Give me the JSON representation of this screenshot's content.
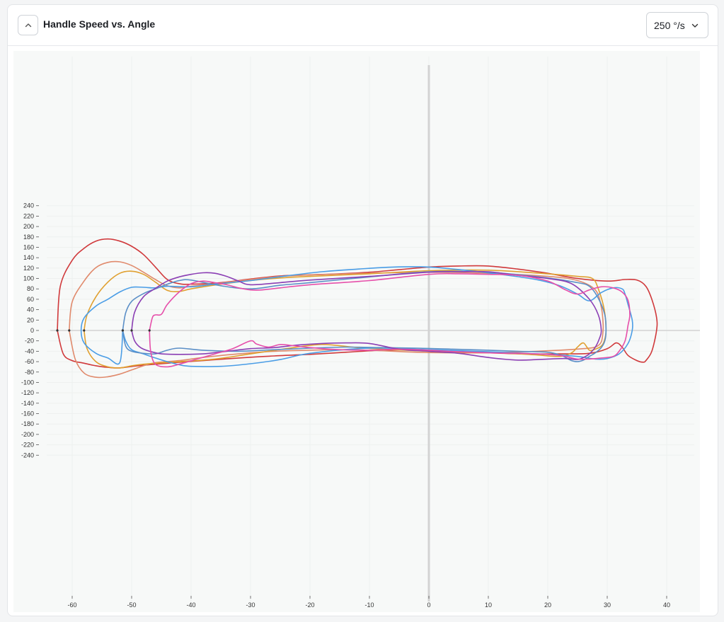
{
  "header": {
    "title": "Handle Speed vs. Angle",
    "speed_select_value": "250 °/s",
    "collapse_icon": "chevron-up-icon",
    "dropdown_icon": "chevron-down-icon"
  },
  "chart_data": {
    "type": "line",
    "title": "Handle Speed vs. Angle",
    "xlabel": "",
    "ylabel": "",
    "xlim": [
      -66,
      46
    ],
    "ylim": [
      -250,
      255
    ],
    "xticks": [
      -60,
      -50,
      -40,
      -30,
      -20,
      -10,
      0,
      10,
      20,
      30,
      40
    ],
    "yticks": [
      240,
      220,
      200,
      180,
      160,
      140,
      120,
      100,
      80,
      60,
      40,
      20,
      0,
      -20,
      -40,
      -60,
      -80,
      -100,
      -120,
      -140,
      -160,
      -180,
      -200,
      -220,
      -240
    ],
    "grid": true,
    "legend": "none",
    "series": [
      {
        "color": "#d0393b",
        "x": [
          -62.5,
          -62,
          -60,
          -58,
          -56,
          -54,
          -52,
          -50,
          -48,
          -46,
          -44,
          -42,
          -40,
          -35,
          -30,
          -25,
          -20,
          -15,
          -10,
          -5,
          0,
          5,
          10,
          15,
          20,
          25,
          30,
          33,
          35,
          36.5,
          37.5,
          38.3,
          38.3,
          37.5,
          36.5,
          36,
          35,
          33.5,
          32.5,
          31.5,
          30,
          27,
          22,
          16,
          10,
          4,
          -2,
          -8,
          -14,
          -20,
          -26,
          -32,
          -38,
          -44,
          -49,
          -52,
          -54,
          -56,
          -58,
          -60,
          -61.5,
          -62.5
        ],
        "y": [
          0,
          85,
          135,
          158,
          172,
          176,
          172,
          162,
          146,
          122,
          98,
          90,
          89,
          92,
          99,
          105,
          107,
          109,
          112,
          117,
          122,
          124,
          124,
          118,
          110,
          100,
          95,
          98,
          97,
          85,
          60,
          25,
          0,
          -40,
          -58,
          -61,
          -58,
          -48,
          -32,
          -24,
          -35,
          -44,
          -45,
          -45,
          -43,
          -41,
          -38,
          -38,
          -42,
          -46,
          -49,
          -53,
          -58,
          -63,
          -68,
          -72,
          -71,
          -68,
          -63,
          -58,
          -45,
          0
        ]
      },
      {
        "color": "#e08a6c",
        "x": [
          -60.5,
          -60,
          -58,
          -56,
          -54,
          -52,
          -50,
          -48,
          -46,
          -44,
          -42,
          -40,
          -35,
          -30,
          -25,
          -20,
          -10,
          0,
          10,
          20,
          25,
          28,
          29,
          29.3,
          29.3,
          29,
          28,
          26,
          22,
          16,
          10,
          4,
          -2,
          -8,
          -14,
          -20,
          -26,
          -32,
          -38,
          -42,
          -46,
          -48,
          -50,
          -52,
          -54,
          -56,
          -58,
          -59.5,
          -60.5
        ],
        "y": [
          0,
          55,
          95,
          121,
          131,
          132,
          125,
          112,
          98,
          86,
          82,
          85,
          91,
          98,
          104,
          107,
          110,
          112,
          110,
          104,
          96,
          78,
          45,
          15,
          0,
          -22,
          -32,
          -35,
          -38,
          -41,
          -43,
          -43,
          -42,
          -39,
          -37,
          -38,
          -40,
          -45,
          -52,
          -58,
          -62,
          -68,
          -76,
          -84,
          -89,
          -90,
          -82,
          -55,
          0
        ]
      },
      {
        "color": "#e0a030",
        "x": [
          -58,
          -57.5,
          -56,
          -54,
          -52,
          -50,
          -48,
          -46,
          -44,
          -42,
          -40,
          -35,
          -30,
          -25,
          -20,
          -10,
          0,
          10,
          20,
          25,
          27.5,
          28.5,
          29.5,
          29.8,
          29.5,
          29,
          28,
          27,
          26,
          25,
          24,
          22,
          18,
          12,
          6,
          0,
          -6,
          -12,
          -18,
          -24,
          -30,
          -36,
          -42,
          -46,
          -48,
          -50,
          -52,
          -54,
          -56,
          -57.5,
          -58
        ],
        "y": [
          0,
          30,
          65,
          93,
          110,
          114,
          108,
          93,
          77,
          75,
          80,
          89,
          96,
          101,
          104,
          109,
          115,
          116,
          109,
          104,
          100,
          80,
          40,
          0,
          -20,
          -30,
          -36,
          -38,
          -24,
          -32,
          -43,
          -50,
          -47,
          -43,
          -42,
          -40,
          -37,
          -33,
          -27,
          -35,
          -45,
          -55,
          -60,
          -63,
          -65,
          -68,
          -72,
          -70,
          -60,
          -35,
          0
        ]
      },
      {
        "color": "#4a9de6",
        "x": [
          -51.5,
          -51,
          -50,
          -48,
          -46,
          -44,
          -42,
          -40,
          -35,
          -30,
          -25,
          -20,
          -10,
          0,
          10,
          20,
          25,
          28,
          30,
          32,
          33.5,
          34.2,
          34.2,
          33.5,
          33,
          32.5,
          31,
          29,
          27,
          25,
          22,
          18,
          12,
          6,
          0,
          -6,
          -12,
          -18,
          -24,
          -30,
          -36,
          -40,
          -44,
          -46,
          -48,
          -50,
          -52,
          -54,
          -56,
          -58,
          -58.5,
          -58,
          -56,
          -54,
          -52,
          -51.5
        ],
        "y": [
          0,
          -20,
          -37,
          -45,
          -53,
          -60,
          -66,
          -69,
          -69,
          -64,
          -56,
          -44,
          -34,
          -37,
          -41,
          -46,
          -50,
          -55,
          -54,
          -45,
          -25,
          0,
          20,
          50,
          70,
          80,
          82,
          73,
          57,
          70,
          86,
          98,
          108,
          116,
          122,
          122,
          118,
          113,
          105,
          96,
          89,
          84,
          85,
          82,
          83,
          83,
          74,
          60,
          47,
          24,
          0,
          -24,
          -44,
          -53,
          -62,
          0
        ]
      },
      {
        "color": "#5b8fc7",
        "x": [
          -51.5,
          -51,
          -50,
          -48,
          -46,
          -44,
          -42,
          -40,
          -35,
          -30,
          -25,
          -20,
          -10,
          0,
          10,
          20,
          25,
          27,
          28.5,
          29.6,
          29.8,
          29.6,
          29,
          28,
          27,
          26,
          25,
          24,
          23,
          22,
          20,
          15,
          10,
          4,
          -2,
          -8,
          -14,
          -20,
          -26,
          -32,
          -38,
          -42,
          -44,
          -46,
          -48,
          -50,
          -51,
          -51.5
        ],
        "y": [
          0,
          34,
          56,
          71,
          80,
          89,
          96,
          97,
          86,
          80,
          87,
          92,
          103,
          113,
          112,
          101,
          92,
          85,
          62,
          30,
          0,
          -20,
          -33,
          -43,
          -50,
          -57,
          -60,
          -58,
          -52,
          -47,
          -42,
          -40,
          -38,
          -36,
          -34,
          -33,
          -32,
          -34,
          -37,
          -40,
          -38,
          -34,
          -38,
          -45,
          -44,
          -40,
          -30,
          0
        ]
      },
      {
        "color": "#8b3fb4",
        "x": [
          -50,
          -49.5,
          -48,
          -46,
          -44,
          -42,
          -40,
          -38,
          -36,
          -34,
          -32,
          -30,
          -25,
          -20,
          -10,
          0,
          5,
          10,
          15,
          20,
          24,
          27,
          28.5,
          29,
          28.7,
          28,
          27,
          26,
          25,
          23,
          20,
          15,
          10,
          5,
          0,
          -5,
          -10,
          -14,
          -18,
          -22,
          -26,
          -30,
          -34,
          -38,
          -42,
          -45,
          -47,
          -48.5,
          -49.5,
          -50
        ],
        "y": [
          0,
          35,
          65,
          81,
          95,
          103,
          108,
          111,
          110,
          104,
          95,
          88,
          92,
          97,
          104,
          112,
          113,
          113,
          106,
          100,
          90,
          60,
          30,
          0,
          -15,
          -32,
          -45,
          -52,
          -56,
          -54,
          -55,
          -57,
          -52,
          -44,
          -40,
          -36,
          -25,
          -24,
          -25,
          -28,
          -33,
          -35,
          -40,
          -45,
          -46,
          -45,
          -40,
          -33,
          -20,
          0
        ]
      },
      {
        "color": "#e64faa",
        "x": [
          -47,
          -46.5,
          -46,
          -45,
          -44,
          -42,
          -40,
          -38,
          -36,
          -34,
          -32,
          -30,
          -28,
          -25,
          -20,
          -10,
          0,
          5,
          10,
          15,
          20,
          23,
          25,
          27,
          29,
          31,
          32.5,
          33.5,
          33.8,
          33.5,
          33,
          32,
          31,
          29,
          27,
          25,
          23,
          21,
          18,
          15,
          10,
          5,
          0,
          -5,
          -10,
          -15,
          -20,
          -23,
          -25,
          -27,
          -29,
          -30,
          -33,
          -36,
          -39,
          -42,
          -44,
          -46,
          -46.8,
          -47
        ],
        "y": [
          0,
          25,
          30,
          31,
          50,
          74,
          90,
          95,
          92,
          88,
          82,
          78,
          78,
          82,
          88,
          96,
          108,
          109,
          108,
          106,
          95,
          78,
          70,
          78,
          84,
          82,
          74,
          58,
          30,
          10,
          -20,
          -40,
          -50,
          -53,
          -55,
          -55,
          -50,
          -47,
          -45,
          -44,
          -43,
          -41,
          -38,
          -36,
          -38,
          -37,
          -33,
          -29,
          -27,
          -32,
          -26,
          -20,
          -35,
          -45,
          -55,
          -65,
          -70,
          -65,
          -40,
          0
        ]
      }
    ]
  }
}
